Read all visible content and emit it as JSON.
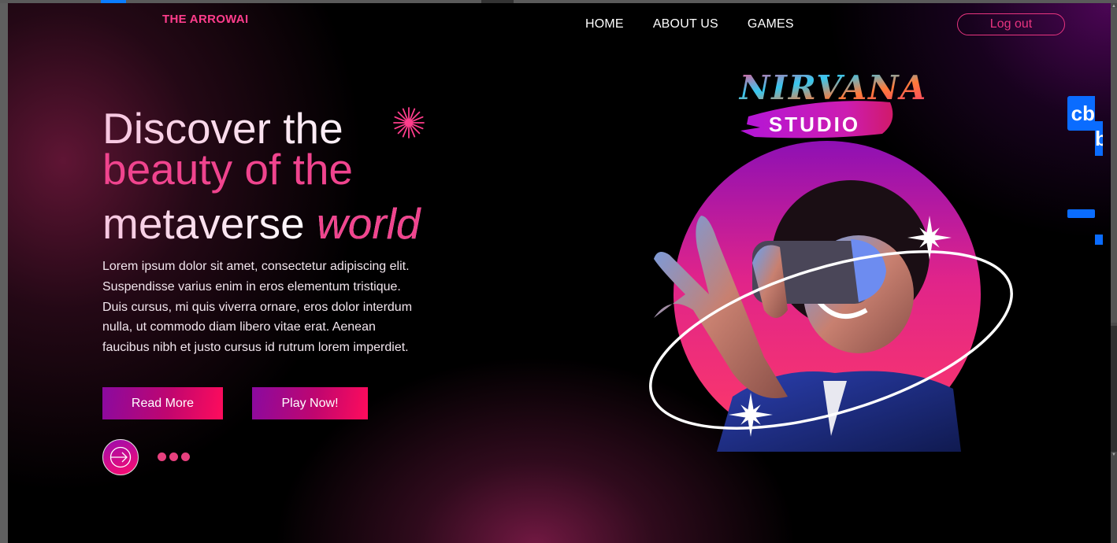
{
  "browser": {
    "scrollbar_label": "vertical-scrollbar"
  },
  "header": {
    "brand": "THE ARROWAI",
    "nav": [
      {
        "label": "HOME"
      },
      {
        "label": "ABOUT US"
      },
      {
        "label": "GAMES"
      }
    ],
    "logout_label": "Log out"
  },
  "hero": {
    "headline_line1": "Discover the",
    "headline_line2": "beauty of the",
    "headline_line3_plain": "metaverse",
    "headline_line3_accent": "world",
    "description": "Lorem ipsum dolor sit amet, consectetur adipiscing elit. Suspendisse varius enim in eros elementum tristique. Duis cursus, mi quis viverra ornare, eros dolor interdum nulla, ut commodo diam libero vitae erat. Aenean faucibus nibh et justo cursus id rutrum lorem imperdiet.",
    "read_more_label": "Read More",
    "play_now_label": "Play Now!",
    "pager_dots": 3
  },
  "studio_logo": {
    "line1": "NIRVANA",
    "line2": "STUDIO"
  },
  "overlay_widget": {
    "label1": "cb",
    "label2": "b"
  },
  "colors": {
    "accent_pink": "#f0448e",
    "button_gradient_start": "#8a0aa0",
    "button_gradient_end": "#ff0c5c",
    "widget_blue": "#0a6cff"
  }
}
